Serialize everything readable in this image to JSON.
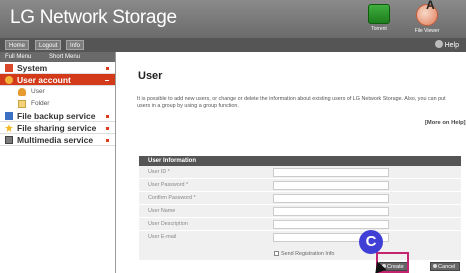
{
  "header": {
    "title": "LG Network Storage",
    "icons": [
      {
        "name": "torrent",
        "label": "Torrent",
        "color": "#2b8f2b"
      },
      {
        "name": "file-viewer",
        "label": "File Viewer",
        "color": "#e07a55"
      }
    ],
    "corner_mark": "A"
  },
  "nav": {
    "buttons": [
      "Home",
      "Logout",
      "Info"
    ],
    "help_label": "Help"
  },
  "sidebar": {
    "tabs": [
      "Full Menu",
      "Short Menu"
    ],
    "items": [
      {
        "label": "System",
        "icon": "system-icon",
        "active": false
      },
      {
        "label": "User account",
        "icon": "user-account-icon",
        "active": true,
        "sub": [
          {
            "label": "User",
            "icon": "user-icon"
          },
          {
            "label": "Folder",
            "icon": "folder-icon"
          }
        ]
      },
      {
        "label": "File backup service",
        "icon": "backup-icon",
        "active": false
      },
      {
        "label": "File sharing service",
        "icon": "sharing-icon",
        "active": false
      },
      {
        "label": "Multimedia service",
        "icon": "multimedia-icon",
        "active": false
      }
    ]
  },
  "main": {
    "title": "User",
    "description": "It is possible to add new users, or change or delete the information about existing users of LG Network Storage. Also, you can put users in a group by using a group function.",
    "more_help": "[More on Help]",
    "form": {
      "header": "User Information",
      "fields": [
        {
          "label": "User ID *",
          "value": ""
        },
        {
          "label": "User Password *",
          "value": ""
        },
        {
          "label": "Confirm Password *",
          "value": ""
        },
        {
          "label": "User Name",
          "value": ""
        },
        {
          "label": "User Description",
          "value": ""
        },
        {
          "label": "User E-mail",
          "value": ""
        }
      ],
      "checkbox_label": "Send Registration Info",
      "create_label": "Create",
      "cancel_label": "Cancel"
    }
  },
  "annotations": {
    "callout": "C"
  },
  "colors": {
    "accent": "#d23a1a",
    "header": "#7a7a7a",
    "callout": "#3f3fd6",
    "callout_box": "#c42370"
  }
}
